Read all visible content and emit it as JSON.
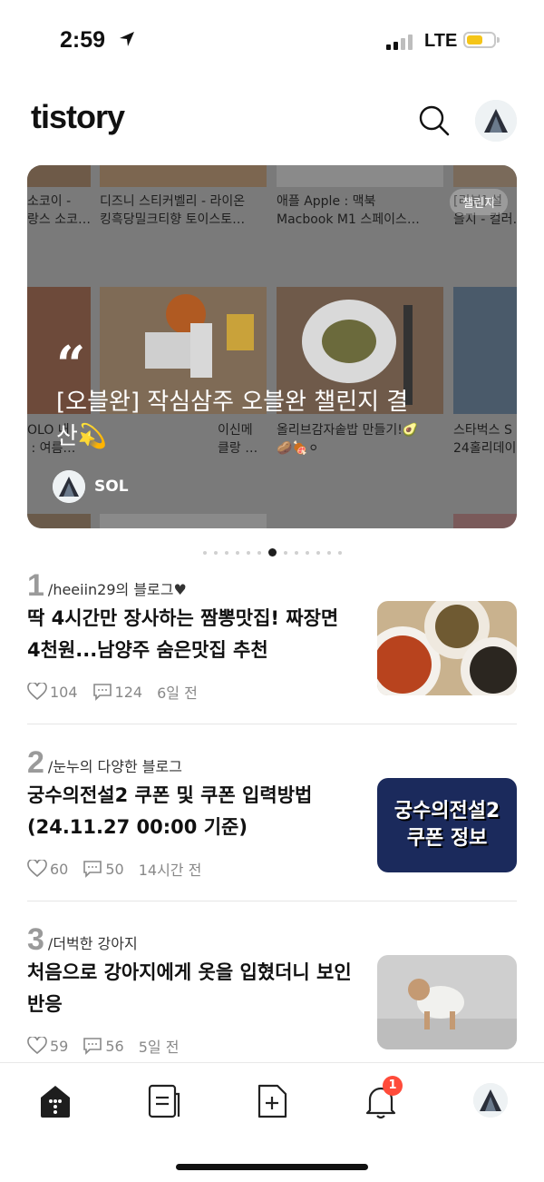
{
  "status_bar": {
    "time": "2:59",
    "network": "LTE"
  },
  "header": {
    "logo": "tistory"
  },
  "banner": {
    "badge": "챌린지",
    "title": "[오블완] 작심삼주 오블완 챌린지 결산💫",
    "author": "SOL",
    "tiles_top": [
      "소코이 -\n랑스 소코…",
      "디즈니 스티커벨리 - 라이온\n킹흑당밀크티향 토이스토…",
      "애플 Apple : 맥북\nMacbook M1 스페이스…",
      "[리뷰] 설\n을지 - 컬러…"
    ],
    "tiles_bottom": [
      "OLO 내\n : 여름…",
      "이신메\n클랑 …",
      "올리브감자솥밥 만들기!🥑\n🥔🍖⚪",
      "스타벅스 S\n24홀리데이"
    ],
    "page_count": 13,
    "active_page": 6
  },
  "items": [
    {
      "rank": "1",
      "blog": "/heeiin29의 블로그♥",
      "title": "딱 4시간만 장사하는 짬뽕맛집! 짜장면 4천원...남양주 숨은맛집 추천",
      "likes": "104",
      "comments": "124",
      "time": "6일 전",
      "thumb_label": ""
    },
    {
      "rank": "2",
      "blog": "/눈누의 다양한 블로그",
      "title": "궁수의전설2 쿠폰 및 쿠폰 입력방법 (24.11.27 00:00 기준)",
      "likes": "60",
      "comments": "50",
      "time": "14시간 전",
      "thumb_label": "궁수의전설2 쿠폰 정보"
    },
    {
      "rank": "3",
      "blog": "/더벅한 강아지",
      "title": "처음으로 강아지에게 옷을 입혔더니 보인 반응",
      "likes": "59",
      "comments": "56",
      "time": "5일 전",
      "thumb_label": ""
    }
  ],
  "nav": {
    "notification_count": "1"
  },
  "colors": {
    "accent_badge": "#ff4b3a",
    "battery": "#f5c518"
  }
}
